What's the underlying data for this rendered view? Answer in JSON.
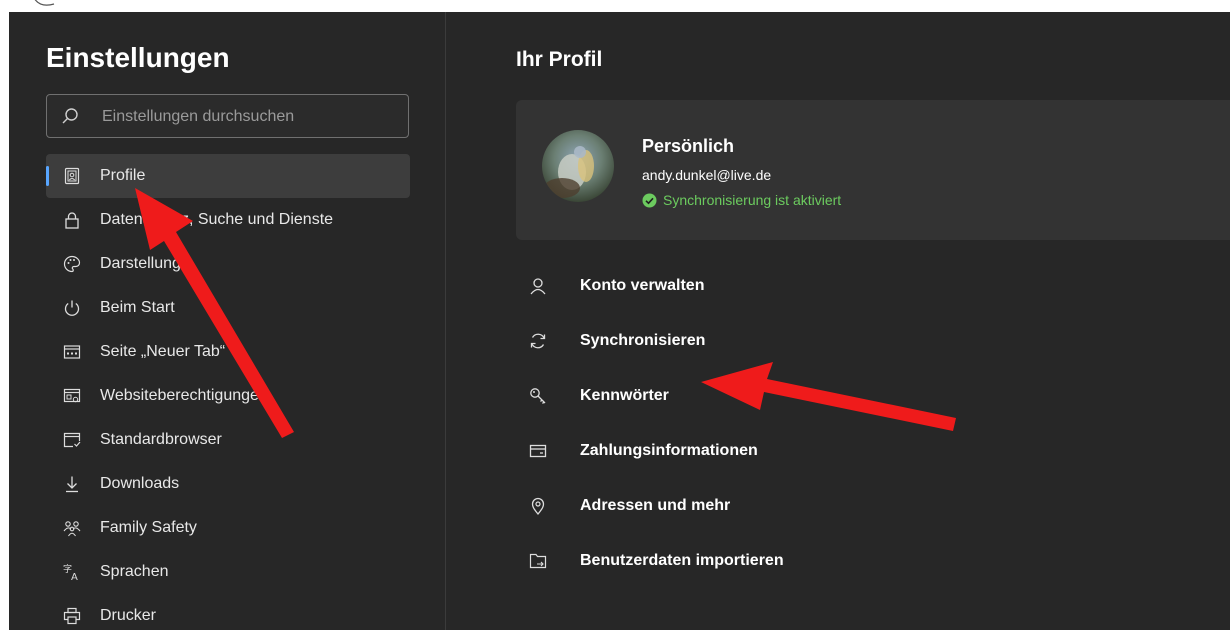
{
  "settings": {
    "title": "Einstellungen",
    "search": {
      "placeholder": "Einstellungen durchsuchen"
    },
    "nav": [
      {
        "label": "Profile",
        "icon": "profile-icon",
        "active": true
      },
      {
        "label": "Datenschutz, Suche und Dienste",
        "icon": "lock-icon"
      },
      {
        "label": "Darstellung",
        "icon": "palette-icon"
      },
      {
        "label": "Beim Start",
        "icon": "power-icon"
      },
      {
        "label": "Seite „Neuer Tab“",
        "icon": "new-tab-icon"
      },
      {
        "label": "Websiteberechtigungen",
        "icon": "site-permissions-icon"
      },
      {
        "label": "Standardbrowser",
        "icon": "default-browser-icon"
      },
      {
        "label": "Downloads",
        "icon": "download-icon"
      },
      {
        "label": "Family Safety",
        "icon": "family-icon"
      },
      {
        "label": "Sprachen",
        "icon": "language-icon"
      },
      {
        "label": "Drucker",
        "icon": "printer-icon"
      }
    ]
  },
  "profile": {
    "heading": "Ihr Profil",
    "card": {
      "name": "Persönlich",
      "email": "andy.dunkel@live.de",
      "sync_status": "Synchronisierung ist aktiviert"
    },
    "options": [
      {
        "label": "Konto verwalten",
        "icon": "person-icon"
      },
      {
        "label": "Synchronisieren",
        "icon": "sync-icon"
      },
      {
        "label": "Kennwörter",
        "icon": "key-icon"
      },
      {
        "label": "Zahlungsinformationen",
        "icon": "card-icon"
      },
      {
        "label": "Adressen und mehr",
        "icon": "location-icon"
      },
      {
        "label": "Benutzerdaten importieren",
        "icon": "import-icon"
      }
    ]
  },
  "colors": {
    "background": "#272727",
    "card": "#333333",
    "accent": "#58a6ff",
    "sync_ok": "#6ccb5f",
    "annotation_arrow": "#ef1b1b"
  }
}
